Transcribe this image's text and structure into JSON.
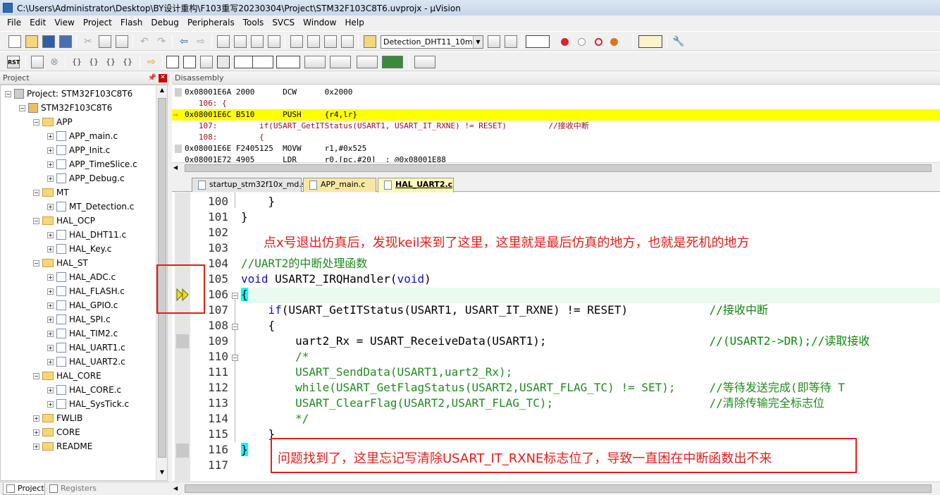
{
  "window": {
    "title": "C:\\Users\\Administrator\\Desktop\\BY设计重构\\F103重写20230304\\Project\\STM32F103C8T6.uvprojx - µVision"
  },
  "menu": [
    "File",
    "Edit",
    "View",
    "Project",
    "Flash",
    "Debug",
    "Peripherals",
    "Tools",
    "SVCS",
    "Window",
    "Help"
  ],
  "toolbar": {
    "target_combo": "Detection_DHT11_10ms",
    "rst_label": "RST"
  },
  "project_panel": {
    "title": "Project",
    "root": "Project: STM32F103C8T6",
    "target": "STM32F103C8T6",
    "tree": [
      {
        "label": "APP",
        "type": "folder",
        "level": 2
      },
      {
        "label": "APP_main.c",
        "type": "file",
        "level": 3
      },
      {
        "label": "APP_Init.c",
        "type": "file",
        "level": 3
      },
      {
        "label": "APP_TimeSlice.c",
        "type": "file",
        "level": 3
      },
      {
        "label": "APP_Debug.c",
        "type": "file",
        "level": 3
      },
      {
        "label": "MT",
        "type": "folder",
        "level": 2
      },
      {
        "label": "MT_Detection.c",
        "type": "file",
        "level": 3
      },
      {
        "label": "HAL_OCP",
        "type": "folder",
        "level": 2
      },
      {
        "label": "HAL_DHT11.c",
        "type": "file",
        "level": 3
      },
      {
        "label": "HAL_Key.c",
        "type": "file",
        "level": 3
      },
      {
        "label": "HAL_ST",
        "type": "folder",
        "level": 2
      },
      {
        "label": "HAL_ADC.c",
        "type": "file",
        "level": 3
      },
      {
        "label": "HAL_FLASH.c",
        "type": "file",
        "level": 3
      },
      {
        "label": "HAL_GPIO.c",
        "type": "file",
        "level": 3
      },
      {
        "label": "HAL_SPI.c",
        "type": "file",
        "level": 3
      },
      {
        "label": "HAL_TIM2.c",
        "type": "file",
        "level": 3
      },
      {
        "label": "HAL_UART1.c",
        "type": "file",
        "level": 3
      },
      {
        "label": "HAL_UART2.c",
        "type": "file",
        "level": 3
      },
      {
        "label": "HAL_CORE",
        "type": "folder",
        "level": 2
      },
      {
        "label": "HAL_CORE.c",
        "type": "file",
        "level": 3
      },
      {
        "label": "HAL_SysTick.c",
        "type": "file",
        "level": 3
      },
      {
        "label": "FWLIB",
        "type": "folder-collapsed",
        "level": 2
      },
      {
        "label": "CORE",
        "type": "folder-collapsed",
        "level": 2
      },
      {
        "label": "README",
        "type": "folder-collapsed",
        "level": 2
      }
    ],
    "bottom_tabs": [
      "Project",
      "Registers"
    ]
  },
  "disassembly": {
    "title": "Disassembly",
    "lines": [
      {
        "text": "0x08001E6A 2000      DCW      0x2000",
        "kind": "asm"
      },
      {
        "text": "   106: {",
        "kind": "src"
      },
      {
        "text": "0x08001E6C B510      PUSH     {r4,lr}",
        "kind": "current"
      },
      {
        "text": "   107:         if(USART_GetITStatus(USART1, USART_IT_RXNE) != RESET)         //接收中断",
        "kind": "src"
      },
      {
        "text": "   108:         {",
        "kind": "src"
      },
      {
        "text": "0x08001E6E F2405125  MOVW     r1,#0x525",
        "kind": "asm"
      },
      {
        "text": "0x08001E72 4905      LDR      r0,[pc,#20]  ; @0x08001E88",
        "kind": "asm"
      }
    ]
  },
  "editor_tabs": [
    {
      "label": "startup_stm32f10x_md.s",
      "state": "normal"
    },
    {
      "label": "APP_main.c",
      "state": "modified"
    },
    {
      "label": "HAL_UART2.c",
      "state": "active"
    }
  ],
  "editor": {
    "lines": [
      {
        "n": "100",
        "code": "    }"
      },
      {
        "n": "101",
        "code": "}"
      },
      {
        "n": "102",
        "code": ""
      },
      {
        "n": "103",
        "code": ""
      },
      {
        "n": "104",
        "code": "//UART2的中断处理函数"
      },
      {
        "n": "105",
        "code": "void USART2_IRQHandler(void)"
      },
      {
        "n": "106",
        "code": "{"
      },
      {
        "n": "107",
        "code": "    if(USART_GetITStatus(USART1, USART_IT_RXNE) != RESET)            //接收中断"
      },
      {
        "n": "108",
        "code": "    {"
      },
      {
        "n": "109",
        "code": "        uart2_Rx = USART_ReceiveData(USART1);                        //(USART2->DR);//读取接收"
      },
      {
        "n": "110",
        "code": "        /*"
      },
      {
        "n": "111",
        "code": "        USART_SendData(USART1,uart2_Rx);"
      },
      {
        "n": "112",
        "code": "        while(USART_GetFlagStatus(USART2,USART_FLAG_TC) != SET);     //等待发送完成(即等待 T"
      },
      {
        "n": "113",
        "code": "        USART_ClearFlag(USART2,USART_FLAG_TC);                       //清除传输完全标志位"
      },
      {
        "n": "114",
        "code": "        */"
      },
      {
        "n": "115",
        "code": "    }"
      },
      {
        "n": "116",
        "code": "}"
      },
      {
        "n": "117",
        "code": ""
      }
    ]
  },
  "annotations": {
    "top": "点x号退出仿真后，发现keil来到了这里，这里就是最后仿真的地方，也就是死机的地方",
    "bottom": "问题找到了，这里忘记写清除USART_IT_RXNE标志位了，导致一直困在中断函数出不来"
  },
  "colors": {
    "current_line": "#ffff00",
    "annotation_red": "#e0201a",
    "comment_green": "#0a8a0a",
    "keyword_blue": "#1010c0",
    "brace_match": "#00ffff"
  }
}
